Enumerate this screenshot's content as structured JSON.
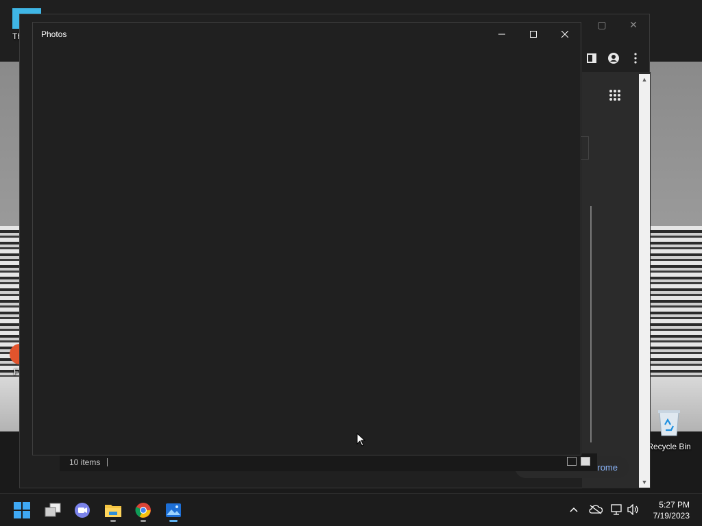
{
  "desktop": {
    "icons": [
      {
        "label": "Th"
      },
      {
        "label": "F"
      },
      {
        "label": "Recycle Bin"
      }
    ]
  },
  "background_window": {
    "status": {
      "items_count": "10 items"
    },
    "chrome_pill_text": "rome"
  },
  "photos_window": {
    "title": "Photos",
    "controls": {
      "minimize": "minimize-icon",
      "maximize": "maximize-icon",
      "close": "close-icon"
    }
  },
  "taskbar": {
    "apps": [
      {
        "name": "Start"
      },
      {
        "name": "Task View"
      },
      {
        "name": "Teams Chat"
      },
      {
        "name": "File Explorer"
      },
      {
        "name": "Google Chrome"
      },
      {
        "name": "Photos"
      }
    ],
    "clock": {
      "time": "5:27 PM",
      "date": "7/19/2023"
    }
  },
  "colors": {
    "window_bg": "#202020",
    "taskbar_bg": "#1c1c1c",
    "accent": "#5fb2f2",
    "link": "#8ab4f8"
  }
}
